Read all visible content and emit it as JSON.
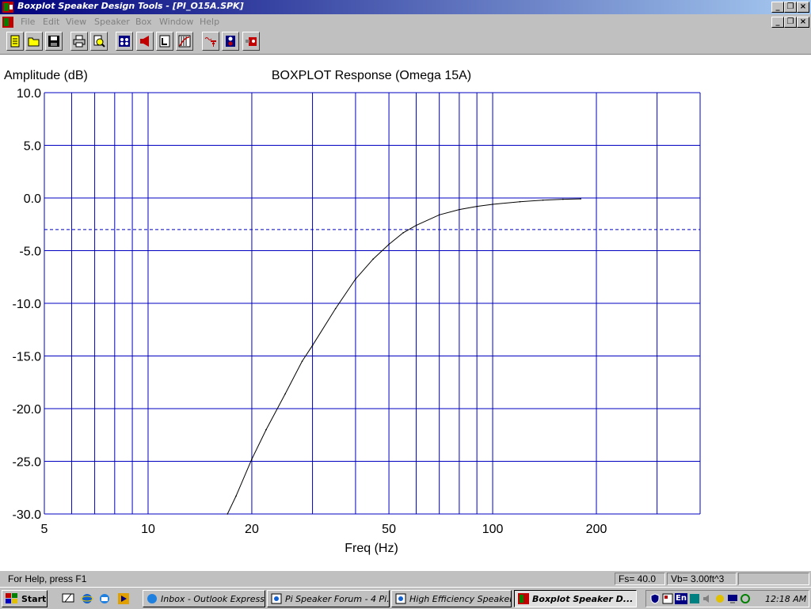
{
  "window": {
    "title": "Boxplot Speaker Design Tools - [PI_O15A.SPK]",
    "controls": [
      "_",
      "▫",
      "×"
    ]
  },
  "menu": {
    "items": [
      {
        "label": "File",
        "name": "menu-file"
      },
      {
        "label": "Edit",
        "name": "menu-edit"
      },
      {
        "label": "View",
        "name": "menu-view"
      },
      {
        "label": "Speaker",
        "name": "menu-speaker"
      },
      {
        "label": "Box",
        "name": "menu-box"
      },
      {
        "label": "Window",
        "name": "menu-window"
      },
      {
        "label": "Help",
        "name": "menu-help"
      }
    ]
  },
  "toolbar": {
    "buttons": [
      "new-icon",
      "open-icon",
      "save-icon",
      "print-icon",
      "print-preview-icon",
      "speaker-params-icon",
      "driver-icon",
      "box-icon",
      "response-graph-icon",
      "filter-icon",
      "enclosure-icon",
      "port-icon"
    ]
  },
  "chart_data": {
    "type": "line",
    "title": "BOXPLOT Response (Omega 15A)",
    "xlabel": "Freq (Hz)",
    "ylabel": "Amplitude (dB)",
    "xscale": "log",
    "xlim": [
      5,
      400
    ],
    "ylim": [
      -30,
      10
    ],
    "xticks": [
      5,
      10,
      20,
      50,
      100,
      200
    ],
    "yticks": [
      "10.0",
      "5.0",
      "0.0",
      "-5.0",
      "-10.0",
      "-15.0",
      "-20.0",
      "-25.0",
      "-30.0"
    ],
    "grid": true,
    "reference_line": {
      "y": -3,
      "style": "dashed"
    },
    "series": [
      {
        "x": [
          17,
          18,
          20,
          22,
          25,
          28,
          30,
          35,
          40,
          45,
          50,
          55,
          60,
          70,
          80,
          90,
          100,
          120,
          140,
          160,
          180
        ],
        "y": [
          -30.0,
          -28.3,
          -24.8,
          -22.0,
          -18.6,
          -15.5,
          -14.0,
          -10.5,
          -7.7,
          -5.8,
          -4.4,
          -3.3,
          -2.6,
          -1.6,
          -1.1,
          -0.8,
          -0.6,
          -0.35,
          -0.2,
          -0.12,
          -0.08
        ]
      }
    ]
  },
  "status": {
    "help": "For Help, press F1",
    "fs": "Fs= 40.0",
    "vb": "Vb=  3.00ft^3",
    "extra": ""
  },
  "taskbar": {
    "start": "Start",
    "tasks": [
      {
        "label": "Inbox - Outlook Express",
        "active": false
      },
      {
        "label": "Pi Speaker Forum - 4 Pi...",
        "active": false
      },
      {
        "label": "High Efficiency Speaker...",
        "active": false
      },
      {
        "label": "Boxplot Speaker D...",
        "active": true
      }
    ],
    "tray_lang": "En",
    "clock": "12:18 AM"
  }
}
